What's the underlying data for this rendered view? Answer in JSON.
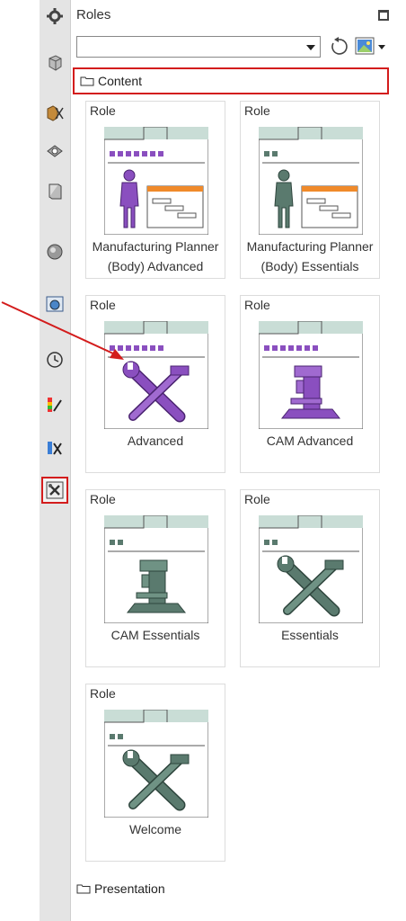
{
  "panel": {
    "title": "Roles",
    "content_folder": "Content",
    "presentation_folder": "Presentation",
    "role_select_value": ""
  },
  "resource_bar": {
    "icons": [
      "settings-icon",
      "assembly-navigator-icon",
      "constraint-navigator-icon",
      "part-navigator-icon",
      "reuse-library-icon",
      "hd3d-tools-icon",
      "web-browser-icon",
      "history-icon",
      "visualization-icon",
      "system-materials-icon",
      "roles-icon"
    ],
    "active": "roles-icon"
  },
  "roles": [
    {
      "tag": "Role",
      "name_line1": "Manufacturing Planner",
      "name_line2": "(Body) Advanced",
      "accent": "#8a4fbf"
    },
    {
      "tag": "Role",
      "name_line1": "Manufacturing Planner",
      "name_line2": "(Body) Essentials",
      "accent": "#5a7a6e"
    },
    {
      "tag": "Role",
      "name_line1": "Advanced",
      "name_line2": "",
      "accent": "#8a4fbf"
    },
    {
      "tag": "Role",
      "name_line1": "CAM Advanced",
      "name_line2": "",
      "accent": "#8a4fbf"
    },
    {
      "tag": "Role",
      "name_line1": "CAM Essentials",
      "name_line2": "",
      "accent": "#5a7a6e"
    },
    {
      "tag": "Role",
      "name_line1": "Essentials",
      "name_line2": "",
      "accent": "#5a7a6e"
    },
    {
      "tag": "Role",
      "name_line1": "Welcome",
      "name_line2": "",
      "accent": "#5a7a6e"
    }
  ],
  "colors": {
    "highlight": "#d31c1c",
    "purple": "#8a4fbf",
    "teal": "#5a7a6e",
    "window_header": "#c9ddd6",
    "orange": "#f08a2a"
  }
}
